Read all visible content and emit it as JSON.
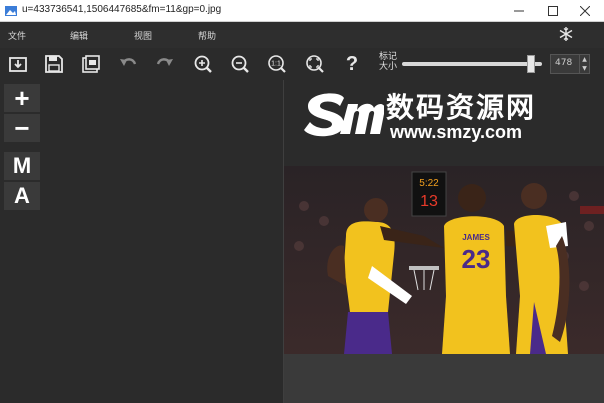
{
  "window": {
    "title": "u=433736541,1506447685&fm=11&gp=0.jpg",
    "icons": {
      "app": "image-app-icon",
      "minimize": "minimize-icon",
      "maximize": "maximize-icon",
      "close": "close-icon"
    }
  },
  "menu": {
    "items": [
      {
        "label": "文件"
      },
      {
        "label": "编辑"
      },
      {
        "label": "视图"
      },
      {
        "label": "帮助"
      }
    ],
    "right_icon": "snowflake-icon"
  },
  "toolbar": {
    "buttons": [
      {
        "name": "open-button",
        "icon": "open-file-icon"
      },
      {
        "name": "save-button",
        "icon": "save-icon"
      },
      {
        "name": "save-as-button",
        "icon": "save-as-icon"
      },
      {
        "name": "undo-button",
        "icon": "undo-icon"
      },
      {
        "name": "redo-button",
        "icon": "redo-icon"
      },
      {
        "name": "zoom-in-button",
        "icon": "zoom-in-icon"
      },
      {
        "name": "zoom-out-button",
        "icon": "zoom-out-icon"
      },
      {
        "name": "actual-size-button",
        "icon": "actual-size-icon"
      },
      {
        "name": "fit-button",
        "icon": "fit-to-window-icon"
      },
      {
        "name": "help-button",
        "icon": "help-icon",
        "label": "?"
      }
    ],
    "one_to_one_label": "1:1",
    "size_label_line1": "标记",
    "size_label_line2": "大小",
    "size_value": "478",
    "slider_fraction": 0.92
  },
  "side": {
    "plus": "+",
    "minus": "−",
    "m": "M",
    "a": "A"
  },
  "watermark": {
    "logo_text": "Sm",
    "cn_text": "数码资源网",
    "url_text": "www.smzy.com"
  },
  "photo": {
    "scoreboard_top": "5:22",
    "scoreboard_bottom": "13",
    "jersey_name": "JAMES",
    "jersey_number": "23",
    "team_colors": {
      "gold": "#f2c21e",
      "purple": "#4a2a8a"
    }
  }
}
